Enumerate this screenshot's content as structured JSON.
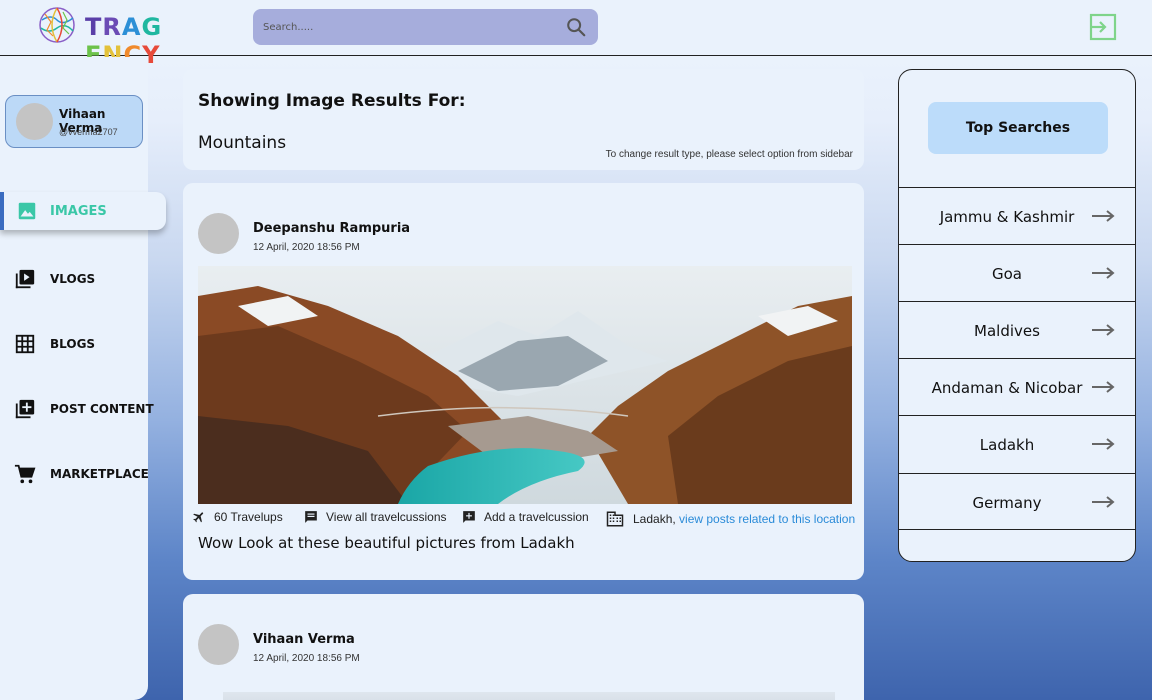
{
  "header": {
    "logo_text": "TRAGENCY",
    "logo_letters": [
      "T",
      "R",
      "A",
      "G",
      "E",
      "N",
      "C",
      "Y"
    ],
    "logo_colors": [
      "#5a3fa8",
      "#6b4bb5",
      "#2c8fd6",
      "#1fb7a0",
      "#6cc24a",
      "#e3c13a",
      "#f08a2c",
      "#e74a3a"
    ],
    "search_placeholder": "Search.....",
    "search_icon": "search-icon",
    "logout_icon": "logout-icon",
    "logout_color": "#7fd48a"
  },
  "profile": {
    "name": "Vihaan Verma",
    "handle": "@vverma2707"
  },
  "sidebar": {
    "items": [
      {
        "label": "IMAGES",
        "icon": "image-icon",
        "active": true
      },
      {
        "label": "VLOGS",
        "icon": "video-library-icon",
        "active": false
      },
      {
        "label": "BLOGS",
        "icon": "grid-icon",
        "active": false
      },
      {
        "label": "POST CONTENT",
        "icon": "add-box-icon",
        "active": false
      },
      {
        "label": "MARKETPLACE",
        "icon": "cart-icon",
        "active": false
      }
    ],
    "active_color": "#3ac7a7"
  },
  "results": {
    "title": "Showing Image Results For:",
    "query": "Mountains",
    "hint": "To change result type, please select option from sidebar"
  },
  "posts": [
    {
      "author": "Deepanshu Rampuria",
      "time": "12 April, 2020 18:56 PM",
      "travelups": "60 Travelups",
      "view_label": "View all travelcussions",
      "add_label": "Add a travelcussion",
      "location": "Ladakh,",
      "location_link": "view posts related to this location",
      "caption": "Wow Look at these beautiful pictures from Ladakh"
    },
    {
      "author": "Vihaan Verma",
      "time": "12 April, 2020 18:56 PM"
    }
  ],
  "top_searches": {
    "title": "Top Searches",
    "items": [
      "Jammu & Kashmir",
      "Goa",
      "Maldives",
      "Andaman & Nicobar",
      "Ladakh",
      "Germany"
    ]
  },
  "colors": {
    "accent": "#3ac7a7",
    "link": "#2a8bd8",
    "search_bg": "#a6addc",
    "top_btn_bg": "#bcdcfa"
  }
}
